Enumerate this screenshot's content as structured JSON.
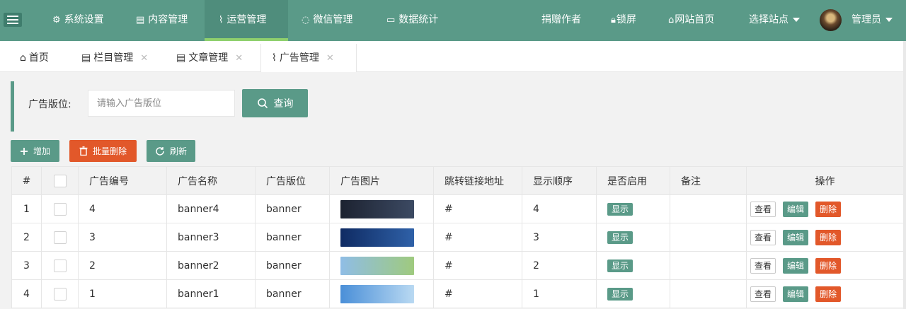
{
  "header": {
    "nav": [
      {
        "label": "系统设置",
        "icon": "gear-icon"
      },
      {
        "label": "内容管理",
        "icon": "document-icon"
      },
      {
        "label": "运营管理",
        "icon": "pulse-icon",
        "active": true
      },
      {
        "label": "微信管理",
        "icon": "chat-icon"
      },
      {
        "label": "数据统计",
        "icon": "chart-icon"
      }
    ],
    "right": {
      "donate": "捐赠作者",
      "lock": "锁屏",
      "home": "网站首页",
      "site": "选择站点",
      "user": "管理员"
    }
  },
  "tabs": [
    {
      "label": "首页",
      "icon": "home-icon",
      "closable": false
    },
    {
      "label": "栏目管理",
      "icon": "clipboard-icon",
      "closable": true
    },
    {
      "label": "文章管理",
      "icon": "clipboard-icon",
      "closable": true
    },
    {
      "label": "广告管理",
      "icon": "pulse-icon",
      "closable": true,
      "active": true
    }
  ],
  "search": {
    "label": "广告版位:",
    "placeholder": "请输入广告版位",
    "button": "查询"
  },
  "toolbar": {
    "add": "增加",
    "batch_delete": "批量删除",
    "refresh": "刷新"
  },
  "table": {
    "columns": [
      "#",
      "",
      "广告编号",
      "广告名称",
      "广告版位",
      "广告图片",
      "跳转链接地址",
      "显示顺序",
      "是否启用",
      "备注",
      "操作"
    ],
    "rows": [
      {
        "index": "1",
        "id": "4",
        "name": "banner4",
        "position": "banner",
        "link": "#",
        "order": "4",
        "enabled": "显示",
        "remark": "",
        "thumb_colors": [
          "#1c2230",
          "#3c4a63"
        ]
      },
      {
        "index": "2",
        "id": "3",
        "name": "banner3",
        "position": "banner",
        "link": "#",
        "order": "3",
        "enabled": "显示",
        "remark": "",
        "thumb_colors": [
          "#0f2b63",
          "#2f61a8"
        ]
      },
      {
        "index": "3",
        "id": "2",
        "name": "banner2",
        "position": "banner",
        "link": "#",
        "order": "2",
        "enabled": "显示",
        "remark": "",
        "thumb_colors": [
          "#8fbde6",
          "#9fca7e"
        ]
      },
      {
        "index": "4",
        "id": "1",
        "name": "banner1",
        "position": "banner",
        "link": "#",
        "order": "1",
        "enabled": "显示",
        "remark": "",
        "thumb_colors": [
          "#4a8fd8",
          "#b9d9f2"
        ]
      }
    ],
    "actions": {
      "view": "查看",
      "edit": "编辑",
      "delete": "删除"
    }
  },
  "colors": {
    "primary": "#5a9a88",
    "danger": "#e2582a",
    "active_bar": "#8fd06d"
  }
}
